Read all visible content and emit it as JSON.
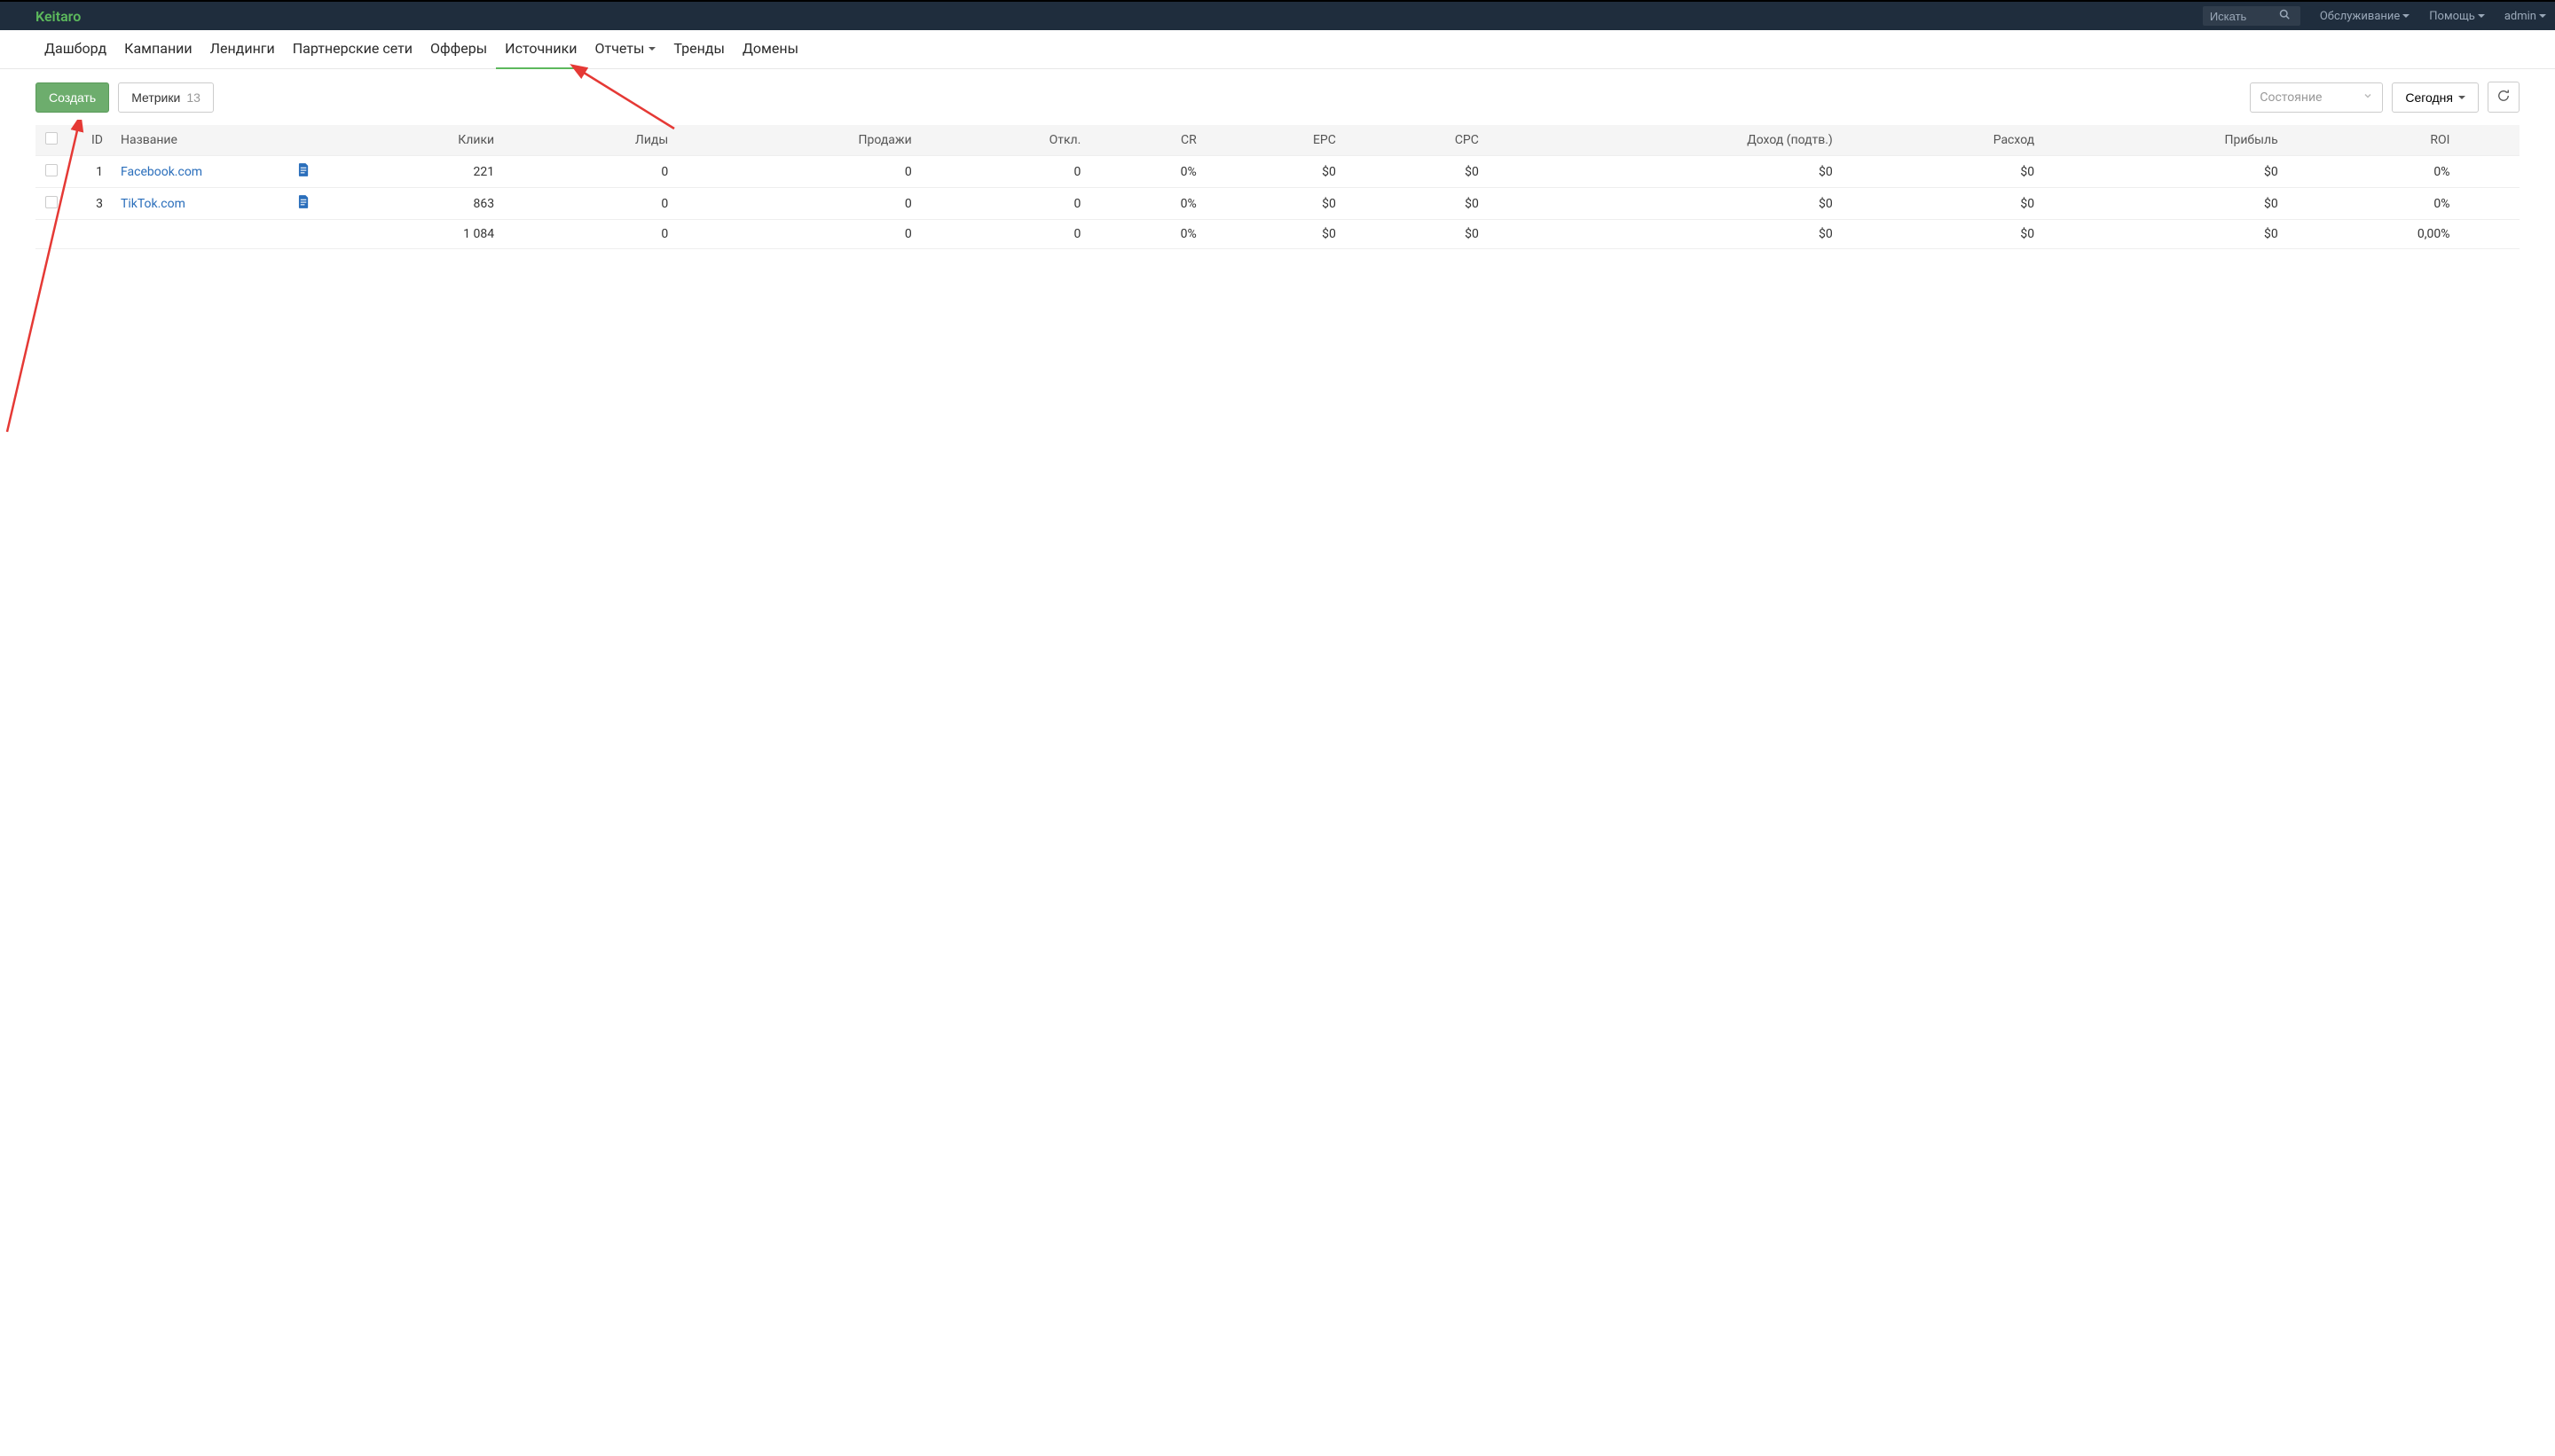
{
  "brand": "Keitaro",
  "search": {
    "placeholder": "Искать"
  },
  "topmenu": {
    "maintenance": "Обслуживание",
    "help": "Помощь",
    "user": "admin"
  },
  "nav": {
    "dashboard": "Дашборд",
    "campaigns": "Кампании",
    "landings": "Лендинги",
    "networks": "Партнерские сети",
    "offers": "Офферы",
    "sources": "Источники",
    "reports": "Отчеты",
    "trends": "Тренды",
    "domains": "Домены"
  },
  "toolbar": {
    "create": "Создать",
    "metrics": "Метрики",
    "metrics_count": "13",
    "state_placeholder": "Состояние",
    "today": "Сегодня"
  },
  "columns": {
    "id": "ID",
    "name": "Название",
    "clicks": "Клики",
    "leads": "Лиды",
    "sales": "Продажи",
    "declines": "Откл.",
    "cr": "CR",
    "epc": "EPC",
    "cpc": "CPC",
    "revenue_confirmed": "Доход (подтв.)",
    "cost": "Расход",
    "profit": "Прибыль",
    "roi": "ROI"
  },
  "rows": [
    {
      "id": "1",
      "name": "Facebook.com",
      "clicks": "221",
      "leads": "0",
      "sales": "0",
      "declines": "0",
      "cr": "0%",
      "epc": "$0",
      "cpc": "$0",
      "revenue_confirmed": "$0",
      "cost": "$0",
      "profit": "$0",
      "roi": "0%"
    },
    {
      "id": "3",
      "name": "TikTok.com",
      "clicks": "863",
      "leads": "0",
      "sales": "0",
      "declines": "0",
      "cr": "0%",
      "epc": "$0",
      "cpc": "$0",
      "revenue_confirmed": "$0",
      "cost": "$0",
      "profit": "$0",
      "roi": "0%"
    }
  ],
  "totals": {
    "clicks": "1 084",
    "leads": "0",
    "sales": "0",
    "declines": "0",
    "cr": "0%",
    "epc": "$0",
    "cpc": "$0",
    "revenue_confirmed": "$0",
    "cost": "$0",
    "profit": "$0",
    "roi": "0,00%"
  }
}
